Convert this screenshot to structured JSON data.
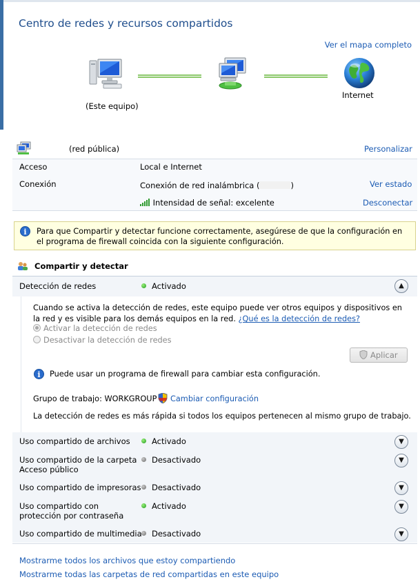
{
  "page": {
    "title": "Centro de redes y recursos compartidos"
  },
  "map": {
    "view_full_map": "Ver el mapa completo",
    "this_computer": "(Este equipo)",
    "internet": "Internet"
  },
  "network": {
    "type": "(red pública)",
    "customize": "Personalizar",
    "access_label": "Acceso",
    "access_value": "Local e Internet",
    "connection_label": "Conexión",
    "connection_value_prefix": "Conexión de red inalámbrica (",
    "connection_value_suffix": ")",
    "view_status": "Ver estado",
    "signal": "Intensidad de señal: excelente",
    "disconnect": "Desconectar"
  },
  "info_banner": {
    "text": "Para que Compartir y detectar funcione correctamente, asegúrese de que la configuración en el programa de firewall coincida con la siguiente configuración."
  },
  "sharing": {
    "title": "Compartir y detectar",
    "discovery": {
      "label": "Detección de redes",
      "status": "Activado",
      "description": "Cuando se activa la detección de redes, este equipo puede ver otros equipos y dispositivos en la red y es visible para los demás equipos en la red.",
      "help_link": "¿Qué es la detección de redes?",
      "option_on": "Activar la detección de redes",
      "option_off": "Desactivar la detección de redes",
      "apply": "Aplicar",
      "firewall_note": "Puede usar un programa de firewall para cambiar esta configuración.",
      "workgroup": "Grupo de trabajo: WORKGROUP",
      "change_settings": "Cambiar configuración",
      "faster_note": "La detección de redes es más rápida si todos los equipos pertenecen al mismo grupo de trabajo."
    },
    "items": [
      {
        "label": "Uso compartido de archivos",
        "status": "Activado"
      },
      {
        "label": "Uso compartido de la carpeta Acceso público",
        "status": "Desactivado"
      },
      {
        "label": "Uso compartido de impresoras",
        "status": "Desactivado"
      },
      {
        "label": "Uso compartido con protección por contraseña",
        "status": "Activado"
      },
      {
        "label": "Uso compartido de multimedia",
        "status": "Desactivado"
      }
    ]
  },
  "footer": {
    "link1": "Mostrarme todos los archivos que estoy compartiendo",
    "link2": "Mostrarme todas las carpetas de red compartidas en este equipo"
  },
  "colors": {
    "accent": "#1e4d8c",
    "link": "#1b5bb3",
    "status_on": "#1f9a1f",
    "status_off": "#6d6d6d"
  }
}
